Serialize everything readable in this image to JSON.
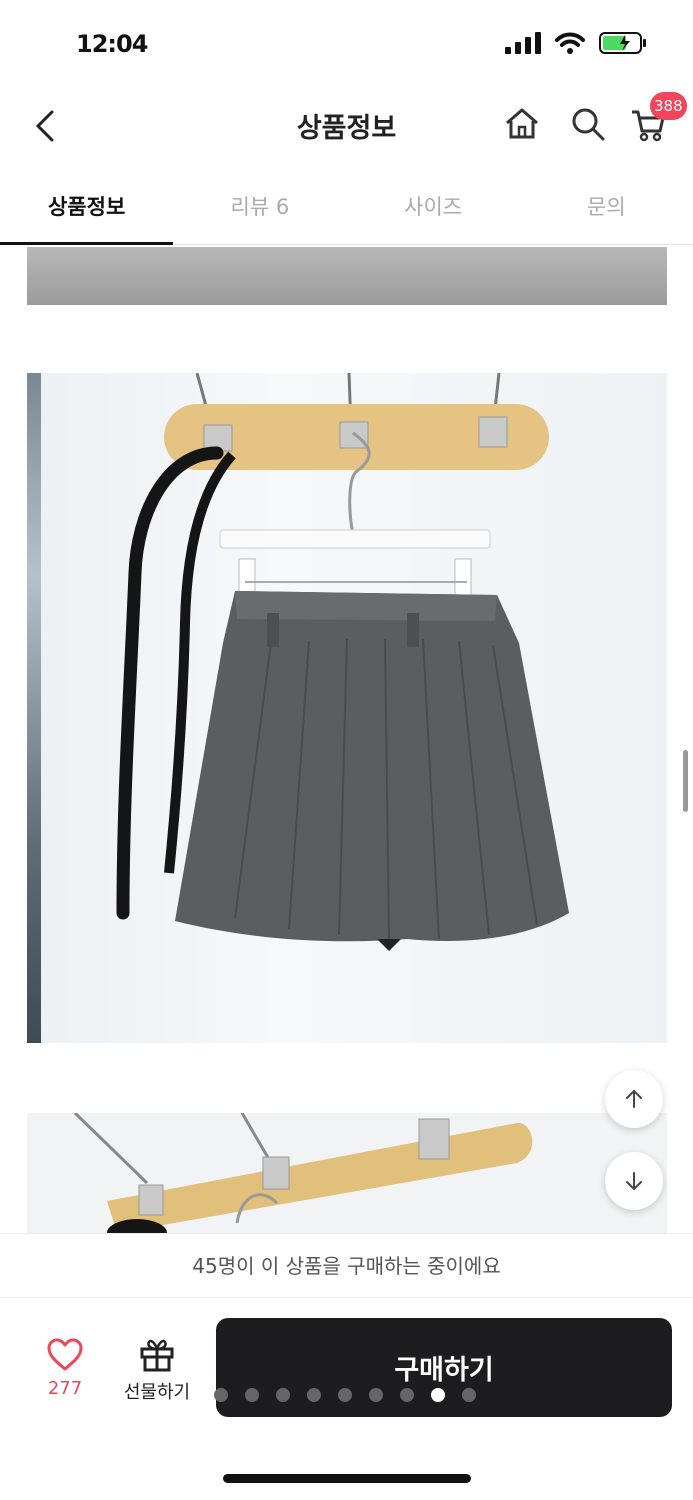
{
  "status_bar": {
    "time": "12:04"
  },
  "header": {
    "title": "상품정보",
    "cart_badge": "388"
  },
  "tabs": [
    {
      "label": "상품정보"
    },
    {
      "label": "리뷰 6"
    },
    {
      "label": "사이즈"
    },
    {
      "label": "문의"
    }
  ],
  "buying_notice": "45명이 이 상품을 구매하는 중이에요",
  "bottom_bar": {
    "like_count": "277",
    "gift_label": "선물하기",
    "buy_label": "구매하기",
    "carousel_total": 9,
    "carousel_active": 8
  },
  "colors": {
    "accent": "#f0455a",
    "button": "#1d1d1f"
  },
  "icons": [
    "back-icon",
    "home-icon",
    "search-icon",
    "cart-icon",
    "arrow-up-icon",
    "arrow-down-icon",
    "heart-icon",
    "gift-icon"
  ]
}
